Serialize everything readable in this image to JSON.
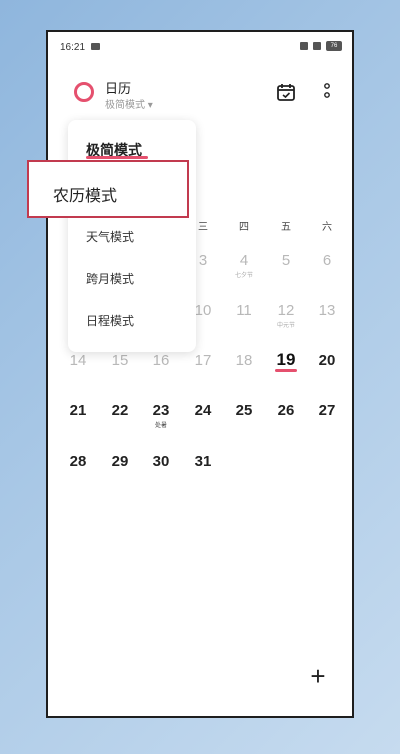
{
  "status_bar": {
    "time": "16:21",
    "battery": "76"
  },
  "header": {
    "title": "日历",
    "subtitle": "极简模式 ▾"
  },
  "weekdays": [
    "三",
    "四",
    "五",
    "六"
  ],
  "mode_menu": {
    "items": [
      "极简模式",
      "天气模式",
      "跨月模式",
      "日程模式"
    ],
    "selected": "极简模式"
  },
  "callout": {
    "label": "农历模式"
  },
  "calendar": {
    "row1": [
      "3",
      "4",
      "5",
      "6"
    ],
    "row1_sub": {
      "4": "七夕节"
    },
    "row2": [
      "10",
      "11",
      "12",
      "13"
    ],
    "row2_sub": {
      "12": "中元节"
    },
    "row3": [
      "14",
      "15",
      "16",
      "17",
      "18",
      "19",
      "20"
    ],
    "row4": [
      "21",
      "22",
      "23",
      "24",
      "25",
      "26",
      "27"
    ],
    "row4_sub": {
      "23": "处暑"
    },
    "row5": [
      "28",
      "29",
      "30",
      "31"
    ],
    "today": "19"
  },
  "fab": {
    "label": "+"
  },
  "colors": {
    "accent": "#e5506e",
    "callout_border": "#c23a4f"
  }
}
